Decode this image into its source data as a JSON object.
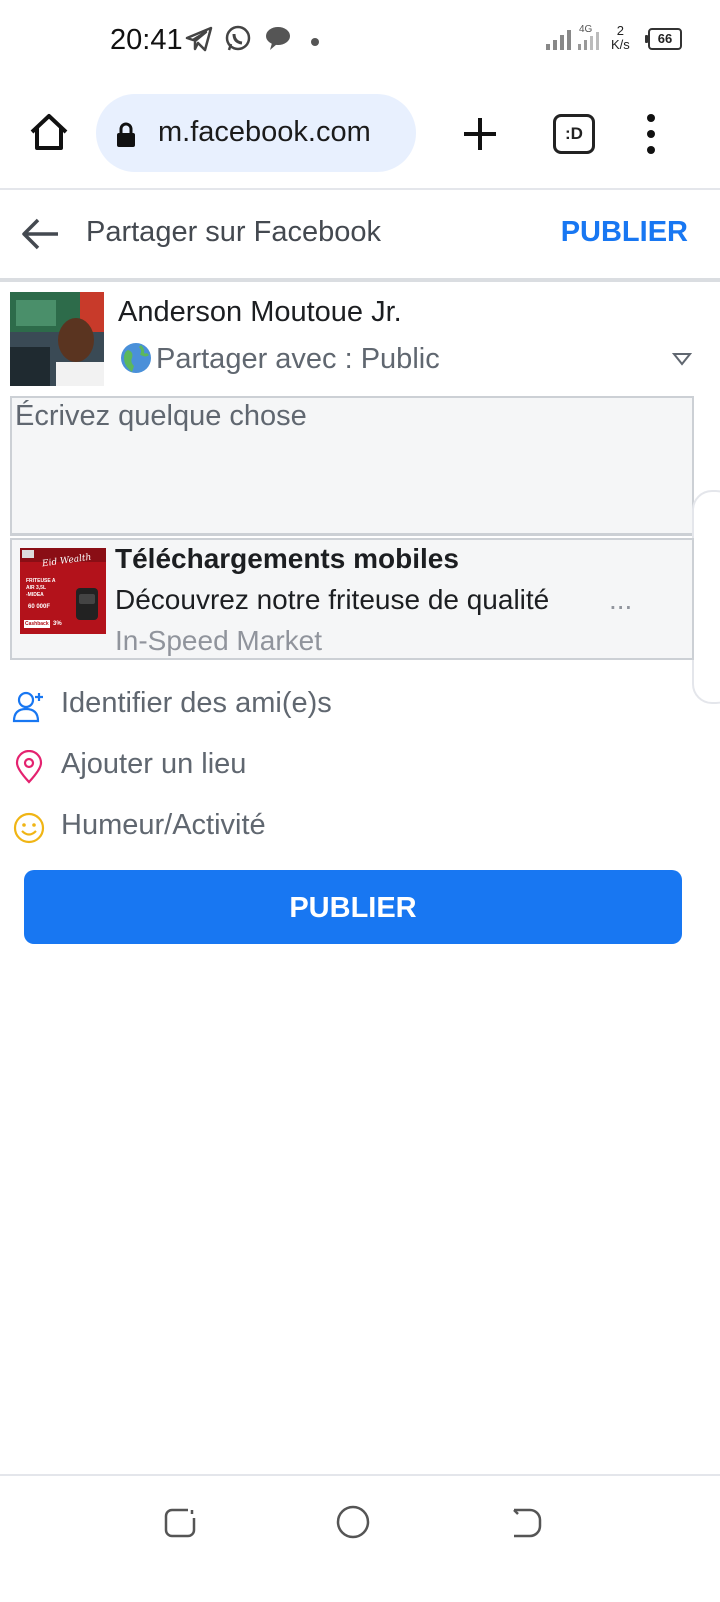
{
  "status_bar": {
    "time": "20:41",
    "net_speed_value": "2",
    "net_speed_unit": "K/s",
    "battery": "66",
    "icons": [
      "telegram-icon",
      "whatsapp-icon",
      "chat-bubble-icon",
      "dot-icon",
      "signal-icon",
      "signal-4g-icon",
      "battery-icon"
    ]
  },
  "browser": {
    "url": "m.facebook.com",
    "tabs_label": ":D"
  },
  "share": {
    "title": "Partager sur Facebook",
    "publish_label": "PUBLIER"
  },
  "user": {
    "name": "Anderson Moutoue Jr.",
    "privacy_label": "Partager avec :  Public"
  },
  "composer": {
    "placeholder": "Écrivez quelque chose"
  },
  "link_preview": {
    "title": "Téléchargements mobiles",
    "description": "Découvrez notre friteuse de qualité",
    "ellipsis": "...",
    "source": "In-Speed Market",
    "thumb_script_text": "Eid Wealth",
    "thumb_lines": [
      "FRITEUSE A",
      "AIR 3,5L",
      "-MIDEA"
    ],
    "thumb_price": "60 000F",
    "thumb_badge": "Cashback",
    "thumb_percent": "3%"
  },
  "options": [
    {
      "label": "Identifier des ami(e)s",
      "icon": "add-friend-icon",
      "color": "#1877f2"
    },
    {
      "label": "Ajouter un lieu",
      "icon": "location-pin-icon",
      "color": "#e4226f"
    },
    {
      "label": "Humeur/Activité",
      "icon": "smiley-icon",
      "color": "#f0b515"
    }
  ],
  "publish_button_label": "PUBLIER",
  "colors": {
    "accent": "#1877f2",
    "muted_text": "#606770",
    "panel_bg": "#f5f6f7"
  }
}
